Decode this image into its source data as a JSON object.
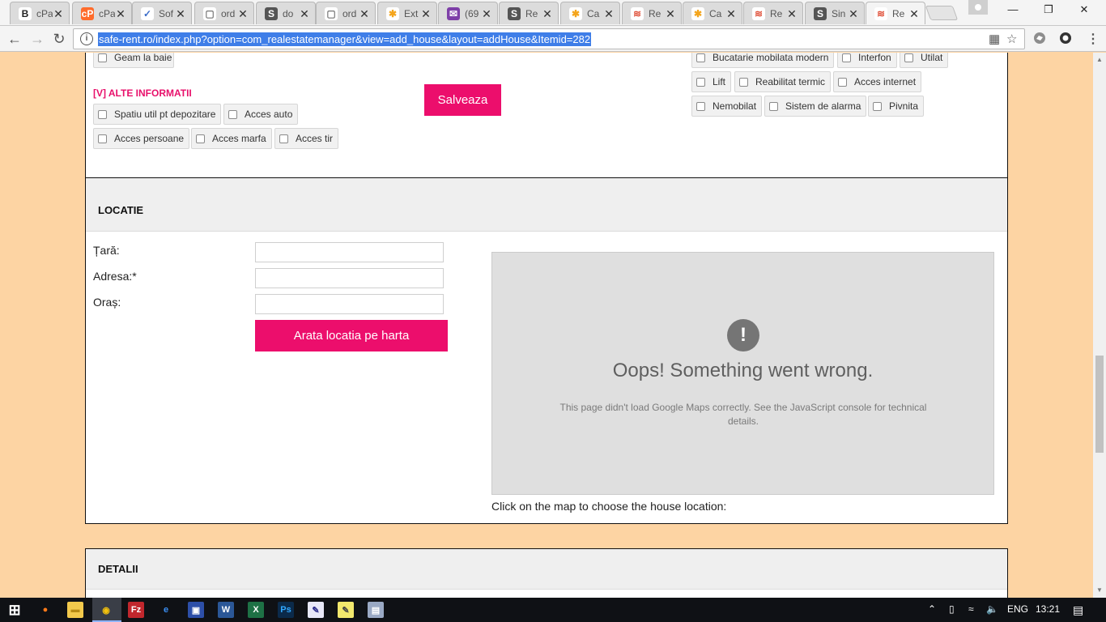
{
  "browser": {
    "tabs": [
      {
        "label": "cPa",
        "fav_text": "B",
        "fav_bg": "#ffffff",
        "fav_fg": "#222222",
        "active": false
      },
      {
        "label": "cPa",
        "fav_text": "cP",
        "fav_bg": "#ff6c2c",
        "fav_fg": "#ffffff",
        "active": false
      },
      {
        "label": "Sof",
        "fav_text": "✓",
        "fav_bg": "#ffffff",
        "fav_fg": "#3a6cc8",
        "active": false
      },
      {
        "label": "ord",
        "fav_text": "▢",
        "fav_bg": "#ffffff",
        "fav_fg": "#777777",
        "active": false
      },
      {
        "label": "do",
        "fav_text": "S",
        "fav_bg": "#555555",
        "fav_fg": "#ffffff",
        "active": false
      },
      {
        "label": "ord",
        "fav_text": "▢",
        "fav_bg": "#ffffff",
        "fav_fg": "#777777",
        "active": false
      },
      {
        "label": "Ext",
        "fav_text": "✱",
        "fav_bg": "#ffffff",
        "fav_fg": "#f4a51c",
        "active": false
      },
      {
        "label": "(69",
        "fav_text": "✉",
        "fav_bg": "#7e3fa8",
        "fav_fg": "#ffffff",
        "active": false
      },
      {
        "label": "Re",
        "fav_text": "S",
        "fav_bg": "#555555",
        "fav_fg": "#ffffff",
        "active": false
      },
      {
        "label": "Ca",
        "fav_text": "✱",
        "fav_bg": "#ffffff",
        "fav_fg": "#f4a51c",
        "active": false
      },
      {
        "label": "Re",
        "fav_text": "≋",
        "fav_bg": "#ffffff",
        "fav_fg": "#e0513a",
        "active": false
      },
      {
        "label": "Ca",
        "fav_text": "✱",
        "fav_bg": "#ffffff",
        "fav_fg": "#f4a51c",
        "active": false
      },
      {
        "label": "Re",
        "fav_text": "≋",
        "fav_bg": "#ffffff",
        "fav_fg": "#e0513a",
        "active": false
      },
      {
        "label": "Sin",
        "fav_text": "S",
        "fav_bg": "#555555",
        "fav_fg": "#ffffff",
        "active": false
      },
      {
        "label": "Re",
        "fav_text": "≋",
        "fav_bg": "#ffffff",
        "fav_fg": "#e0513a",
        "active": true
      }
    ],
    "tab_close_glyph": "✕",
    "url": "safe-rent.ro/index.php?option=com_realestatemanager&view=add_house&layout=addHouse&Itemid=282",
    "window_controls": {
      "minimize": "—",
      "restore": "❐",
      "close": "✕"
    }
  },
  "page": {
    "top_section": {
      "partial_checkbox": "Geam la baie",
      "alte_informatii_label": "[V] ALTE INFORMATII",
      "alte_informatii": [
        "Spatiu util pt depozitare",
        "Acces auto",
        "Acces persoane",
        "Acces marfa",
        "Acces tir"
      ],
      "save_button": "Salveaza",
      "right_checkboxes_row1": [
        "Bucatarie mobilata modern",
        "Interfon",
        "Utilat"
      ],
      "right_checkboxes_row2": [
        "Lift",
        "Reabilitat termic",
        "Acces internet"
      ],
      "right_checkboxes_row3": [
        "Nemobilat",
        "Sistem de alarma",
        "Pivnita"
      ]
    },
    "locatie": {
      "title": "LOCATIE",
      "country_label": "Țară:",
      "address_label": "Adresa:*",
      "city_label": "Oraș:",
      "country_value": "",
      "address_value": "",
      "city_value": "",
      "show_map_button": "Arata locatia pe harta",
      "map_error_icon": "!",
      "map_error_title": "Oops! Something went wrong.",
      "map_error_message": "This page didn't load Google Maps correctly. See the JavaScript console for technical details.",
      "map_hint": "Click on the map to choose the house location:"
    },
    "detalii": {
      "title": "DETALII"
    }
  },
  "taskbar": {
    "apps": [
      {
        "name": "windows-start-icon",
        "glyph": "⊞",
        "bg": "transparent",
        "fg": "#ffffff"
      },
      {
        "name": "firefox-icon",
        "glyph": "●",
        "bg": "transparent",
        "fg": "#ff7a1a"
      },
      {
        "name": "file-explorer-icon",
        "glyph": "▬",
        "bg": "#f2c94c",
        "fg": "#b68a14"
      },
      {
        "name": "chrome-icon",
        "glyph": "◉",
        "bg": "transparent",
        "fg": "#f4c20d"
      },
      {
        "name": "filezilla-icon",
        "glyph": "Fz",
        "bg": "#c1272d",
        "fg": "#ffffff"
      },
      {
        "name": "edge-icon",
        "glyph": "e",
        "bg": "transparent",
        "fg": "#3b8ff3"
      },
      {
        "name": "save-disk-icon",
        "glyph": "▣",
        "bg": "#2d4fa8",
        "fg": "#ffffff"
      },
      {
        "name": "word-icon",
        "glyph": "W",
        "bg": "#2b5797",
        "fg": "#ffffff"
      },
      {
        "name": "excel-icon",
        "glyph": "X",
        "bg": "#1e7145",
        "fg": "#ffffff"
      },
      {
        "name": "photoshop-icon",
        "glyph": "Ps",
        "bg": "#0b2a4a",
        "fg": "#31a8ff"
      },
      {
        "name": "notepad-icon",
        "glyph": "✎",
        "bg": "#e8e8f8",
        "fg": "#2a2a8a"
      },
      {
        "name": "notes-icon",
        "glyph": "✎",
        "bg": "#f2e86d",
        "fg": "#444444"
      },
      {
        "name": "document-icon",
        "glyph": "▤",
        "bg": "#9aa9c4",
        "fg": "#ffffff"
      }
    ],
    "language": "ENG",
    "time": "13:21"
  }
}
